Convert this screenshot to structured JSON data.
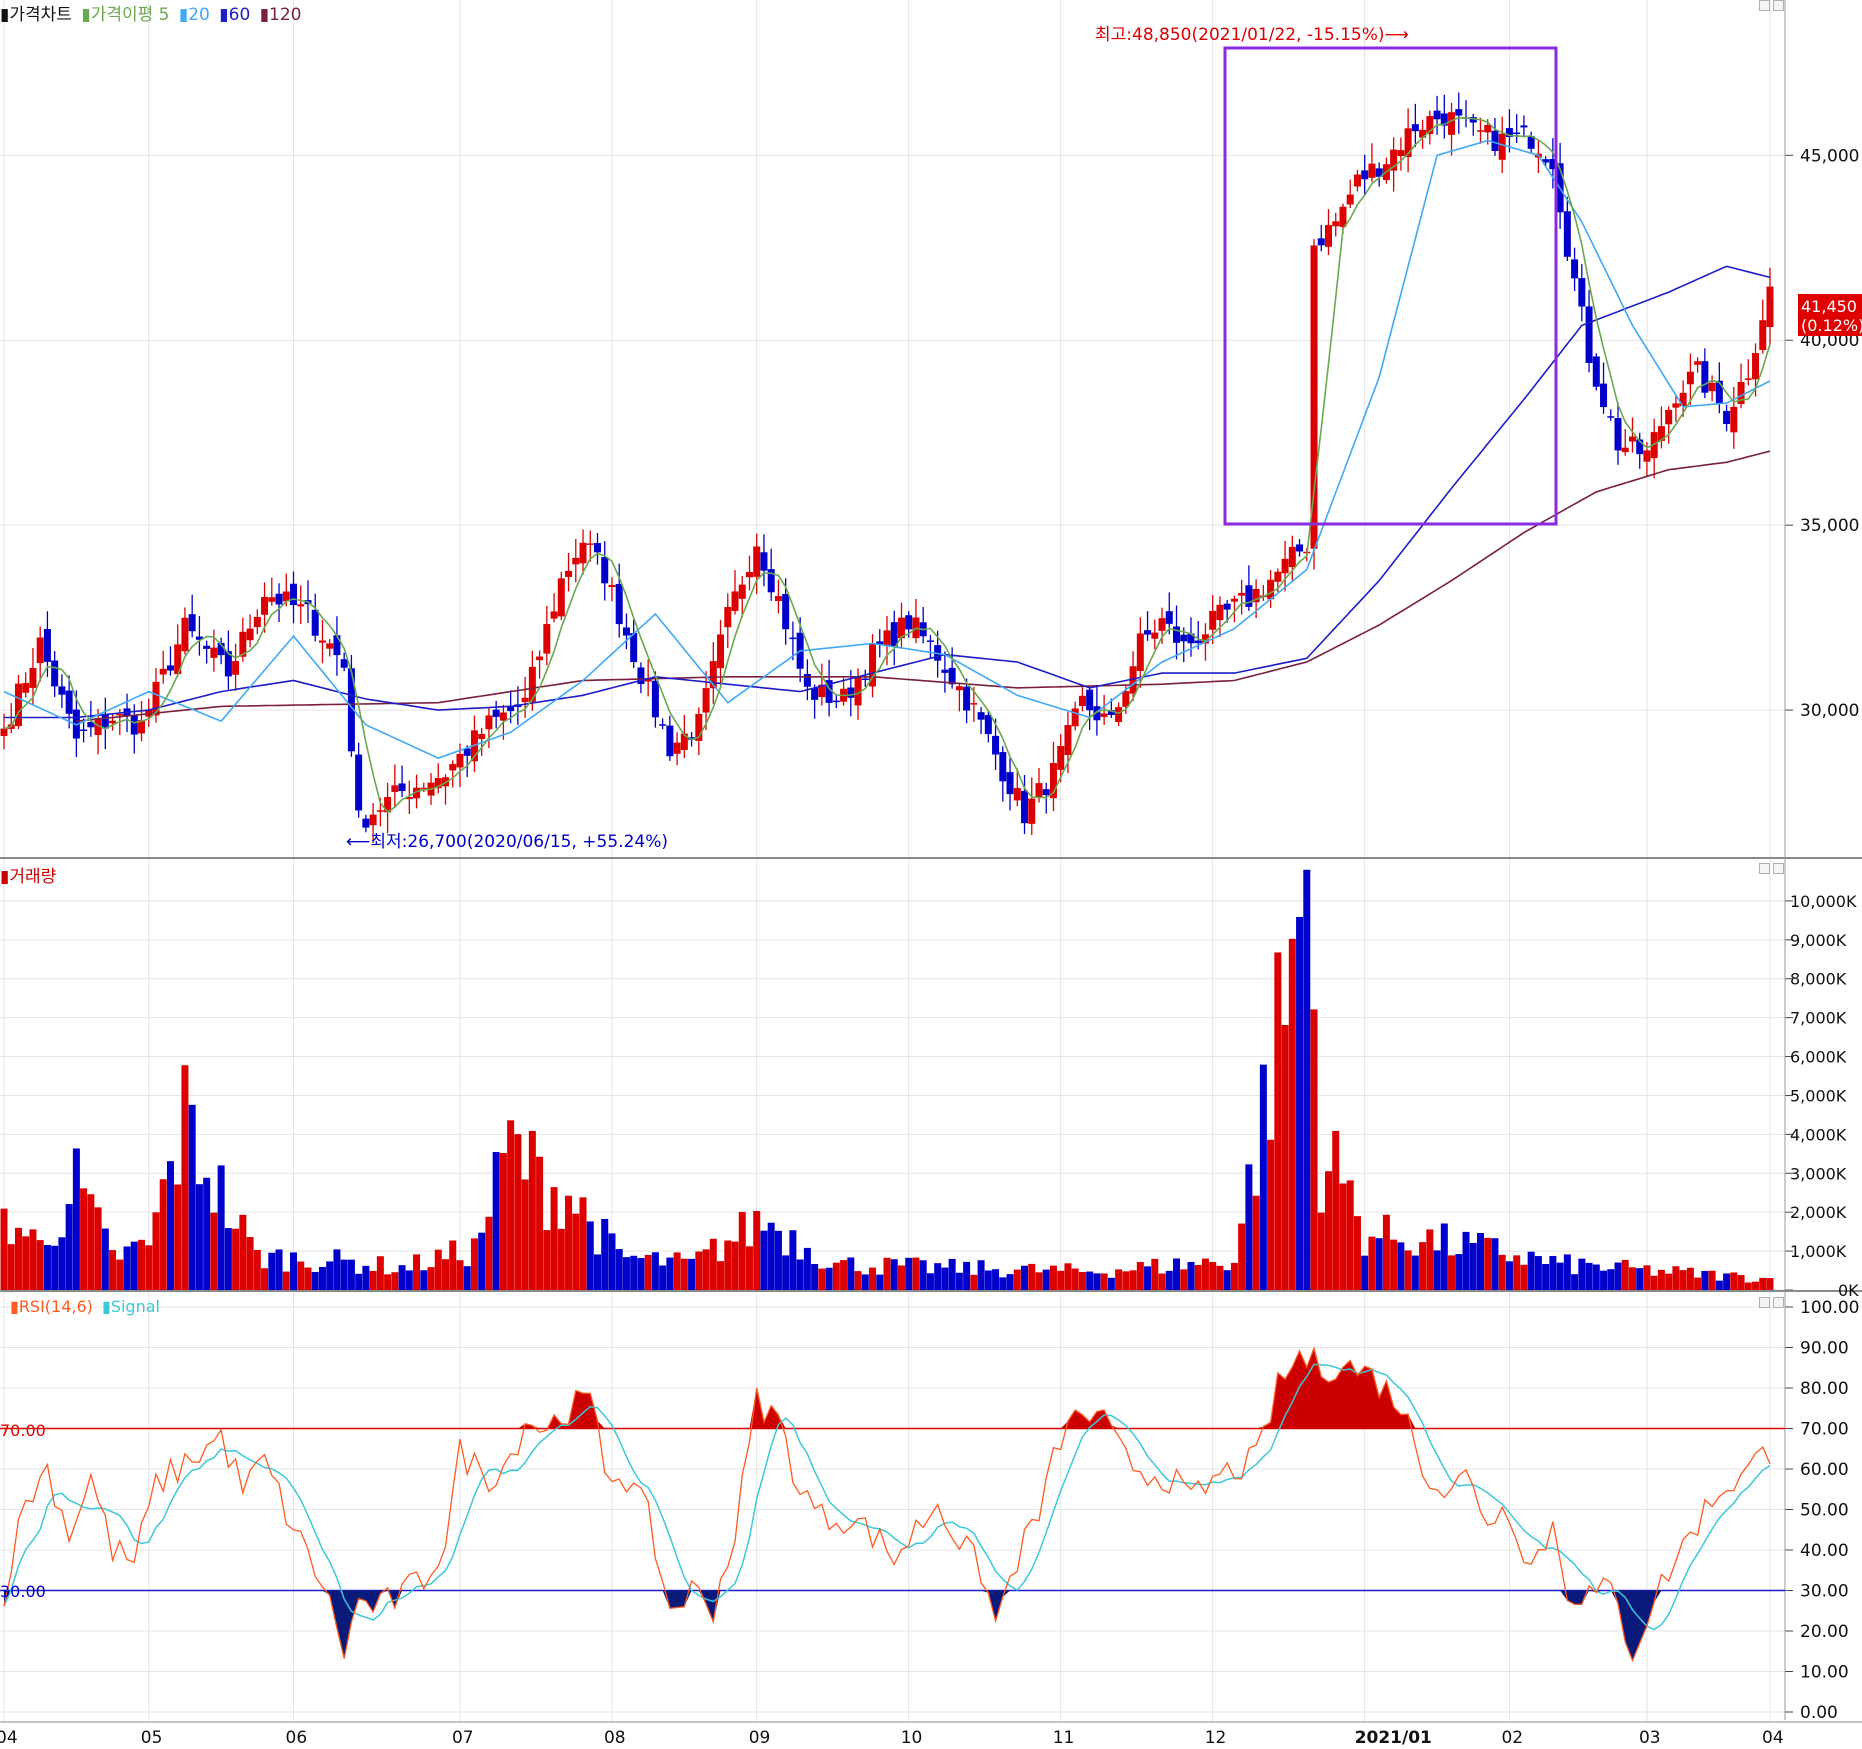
{
  "price_legend": {
    "items": [
      {
        "label": "가격차트",
        "color": "#111111"
      },
      {
        "label": "가격이평 5",
        "color": "#6aa84f"
      },
      {
        "label": "20",
        "color": "#3fa9f5"
      },
      {
        "label": "60",
        "color": "#1c1cc8"
      },
      {
        "label": "120",
        "color": "#7a1f3d"
      }
    ]
  },
  "volume_legend": {
    "label": "거래량",
    "color": "#cc0000"
  },
  "rsi_legend": {
    "items": [
      {
        "label": "RSI(14,6)",
        "color": "#ff5a1f"
      },
      {
        "label": "Signal",
        "color": "#3cc8d8"
      }
    ]
  },
  "annotations": {
    "high": "최고:48,850(2021/01/22, -15.15%)⟶",
    "low": "⟵최저:26,700(2020/06/15, +55.24%)",
    "last_price": "41,450",
    "last_change": "(0.12%)"
  },
  "colors": {
    "up": "#dd0000",
    "down": "#0000cc",
    "grid": "#e4e4e4",
    "box": "#8a2be2"
  },
  "chart_data": [
    {
      "type": "candlestick",
      "title": "가격차트",
      "x_ticks": [
        "04",
        "05",
        "06",
        "07",
        "08",
        "09",
        "10",
        "11",
        "12",
        "2021/01",
        "02",
        "03",
        "04"
      ],
      "y_ticks": [
        "30,000",
        "35,000",
        "40,000",
        "45,000"
      ],
      "ylim": [
        26000,
        49200
      ],
      "high": {
        "value": 48850,
        "date": "2021/01/22"
      },
      "low": {
        "value": 26700,
        "date": "2020/06/15"
      },
      "last": 41450,
      "series": [
        {
          "name": "가격차트",
          "kind": "candles",
          "anchors": [
            [
              0,
              29500
            ],
            [
              5,
              31800
            ],
            [
              10,
              29200
            ],
            [
              15,
              29800
            ],
            [
              19,
              29600
            ],
            [
              25,
              32200
            ],
            [
              31,
              31000
            ],
            [
              36,
              33200
            ],
            [
              42,
              32600
            ],
            [
              47,
              31200
            ],
            [
              49,
              27000
            ],
            [
              55,
              27800
            ],
            [
              61,
              28300
            ],
            [
              67,
              29600
            ],
            [
              72,
              30200
            ],
            [
              77,
              33500
            ],
            [
              80,
              34600
            ],
            [
              83,
              33700
            ],
            [
              88,
              31000
            ],
            [
              92,
              29000
            ],
            [
              96,
              29600
            ],
            [
              100,
              32500
            ],
            [
              104,
              34600
            ],
            [
              107,
              33000
            ],
            [
              111,
              30500
            ],
            [
              116,
              30300
            ],
            [
              120,
              31500
            ],
            [
              125,
              32400
            ],
            [
              129,
              31500
            ],
            [
              134,
              30000
            ],
            [
              137,
              28800
            ],
            [
              141,
              27200
            ],
            [
              145,
              28300
            ],
            [
              149,
              30200
            ],
            [
              153,
              29600
            ],
            [
              157,
              31800
            ],
            [
              160,
              32400
            ],
            [
              163,
              31700
            ],
            [
              168,
              32500
            ],
            [
              172,
              33000
            ],
            [
              176,
              33700
            ],
            [
              180,
              34500
            ],
            [
              181,
              42600
            ],
            [
              184,
              43200
            ],
            [
              187,
              44300
            ],
            [
              191,
              44900
            ],
            [
              195,
              45800
            ],
            [
              199,
              46100
            ],
            [
              203,
              45600
            ],
            [
              207,
              45400
            ],
            [
              211,
              45500
            ],
            [
              214,
              44900
            ],
            [
              216,
              42600
            ],
            [
              219,
              39600
            ],
            [
              223,
              37200
            ],
            [
              227,
              36900
            ],
            [
              231,
              38600
            ],
            [
              234,
              39100
            ],
            [
              238,
              38000
            ],
            [
              241,
              39200
            ],
            [
              244,
              41450
            ]
          ]
        },
        {
          "name": "가격이평 5",
          "kind": "line"
        },
        {
          "name": "20",
          "kind": "line",
          "anchors": [
            [
              0,
              30500
            ],
            [
              10,
              29600
            ],
            [
              20,
              30500
            ],
            [
              30,
              29700
            ],
            [
              40,
              32000
            ],
            [
              50,
              29600
            ],
            [
              60,
              28700
            ],
            [
              70,
              29400
            ],
            [
              80,
              30800
            ],
            [
              90,
              32600
            ],
            [
              100,
              30200
            ],
            [
              110,
              31600
            ],
            [
              120,
              31800
            ],
            [
              130,
              31500
            ],
            [
              140,
              30400
            ],
            [
              150,
              29800
            ],
            [
              160,
              31300
            ],
            [
              170,
              32200
            ],
            [
              180,
              33800
            ],
            [
              190,
              39000
            ],
            [
              198,
              45000
            ],
            [
              205,
              45400
            ],
            [
              212,
              45000
            ],
            [
              218,
              43200
            ],
            [
              225,
              40400
            ],
            [
              232,
              38200
            ],
            [
              238,
              38300
            ],
            [
              244,
              38900
            ]
          ]
        },
        {
          "name": "60",
          "kind": "line",
          "anchors": [
            [
              0,
              29800
            ],
            [
              10,
              29800
            ],
            [
              20,
              30000
            ],
            [
              30,
              30500
            ],
            [
              40,
              30800
            ],
            [
              50,
              30300
            ],
            [
              60,
              30000
            ],
            [
              70,
              30100
            ],
            [
              80,
              30400
            ],
            [
              90,
              30900
            ],
            [
              100,
              30700
            ],
            [
              110,
              30500
            ],
            [
              120,
              31000
            ],
            [
              130,
              31500
            ],
            [
              140,
              31300
            ],
            [
              150,
              30600
            ],
            [
              160,
              31000
            ],
            [
              170,
              31000
            ],
            [
              180,
              31400
            ],
            [
              190,
              33500
            ],
            [
              200,
              36000
            ],
            [
              210,
              38400
            ],
            [
              218,
              40400
            ],
            [
              230,
              41300
            ],
            [
              238,
              42000
            ],
            [
              244,
              41700
            ]
          ]
        },
        {
          "name": "120",
          "kind": "line",
          "anchors": [
            [
              10,
              29700
            ],
            [
              30,
              30100
            ],
            [
              60,
              30200
            ],
            [
              80,
              30800
            ],
            [
              100,
              30900
            ],
            [
              120,
              30900
            ],
            [
              140,
              30600
            ],
            [
              160,
              30700
            ],
            [
              170,
              30800
            ],
            [
              180,
              31300
            ],
            [
              190,
              32300
            ],
            [
              200,
              33500
            ],
            [
              210,
              34800
            ],
            [
              220,
              35900
            ],
            [
              230,
              36500
            ],
            [
              238,
              36700
            ],
            [
              244,
              37000
            ]
          ]
        }
      ]
    },
    {
      "type": "bar",
      "title": "거래량",
      "y_ticks": [
        "0K",
        "1,000K",
        "2,000K",
        "3,000K",
        "4,000K",
        "5,000K",
        "6,000K",
        "7,000K",
        "8,000K",
        "9,000K",
        "10,000K"
      ],
      "ylim": [
        0,
        11000
      ],
      "unit": "K",
      "peak": {
        "value": 10800,
        "date": "2020/12/31"
      },
      "anchors": [
        [
          0,
          2000
        ],
        [
          5,
          1200
        ],
        [
          10,
          2800
        ],
        [
          15,
          900
        ],
        [
          20,
          1200
        ],
        [
          25,
          4600
        ],
        [
          31,
          2200
        ],
        [
          35,
          900
        ],
        [
          45,
          800
        ],
        [
          55,
          600
        ],
        [
          65,
          1100
        ],
        [
          70,
          3900
        ],
        [
          75,
          2800
        ],
        [
          78,
          2600
        ],
        [
          85,
          900
        ],
        [
          95,
          700
        ],
        [
          105,
          1900
        ],
        [
          115,
          700
        ],
        [
          130,
          600
        ],
        [
          150,
          500
        ],
        [
          170,
          800
        ],
        [
          180,
          10800
        ],
        [
          182,
          3600
        ],
        [
          185,
          3000
        ],
        [
          188,
          1500
        ],
        [
          195,
          1400
        ],
        [
          205,
          1100
        ],
        [
          215,
          700
        ],
        [
          244,
          300
        ]
      ]
    },
    {
      "type": "line",
      "title": "RSI(14,6)",
      "y_ticks": [
        "0.00",
        "10.00",
        "20.00",
        "30.00",
        "40.00",
        "50.00",
        "60.00",
        "70.00",
        "80.00",
        "90.00",
        "100.00"
      ],
      "ylim": [
        0,
        100
      ],
      "reference_lines": [
        {
          "value": 70,
          "label": "70.00"
        },
        {
          "value": 30,
          "label": "30.00"
        }
      ],
      "series": [
        {
          "name": "RSI(14,6)",
          "anchors": [
            [
              0,
              30
            ],
            [
              3,
              52
            ],
            [
              6,
              60
            ],
            [
              9,
              44
            ],
            [
              12,
              58
            ],
            [
              15,
              40
            ],
            [
              18,
              37
            ],
            [
              21,
              56
            ],
            [
              24,
              60
            ],
            [
              27,
              64
            ],
            [
              30,
              68
            ],
            [
              33,
              55
            ],
            [
              36,
              62
            ],
            [
              40,
              45
            ],
            [
              44,
              32
            ],
            [
              47,
              15
            ],
            [
              49,
              27
            ],
            [
              52,
              26
            ],
            [
              55,
              29
            ],
            [
              58,
              33
            ],
            [
              61,
              42
            ],
            [
              63,
              64
            ],
            [
              67,
              58
            ],
            [
              70,
              63
            ],
            [
              72,
              72
            ],
            [
              75,
              70
            ],
            [
              78,
              75
            ],
            [
              81,
              77
            ],
            [
              83,
              60
            ],
            [
              86,
              58
            ],
            [
              89,
              48
            ],
            [
              92,
              25
            ],
            [
              95,
              30
            ],
            [
              98,
              26
            ],
            [
              101,
              44
            ],
            [
              104,
              77
            ],
            [
              107,
              72
            ],
            [
              110,
              55
            ],
            [
              113,
              48
            ],
            [
              117,
              48
            ],
            [
              120,
              44
            ],
            [
              123,
              38
            ],
            [
              126,
              45
            ],
            [
              129,
              52
            ],
            [
              132,
              42
            ],
            [
              135,
              35
            ],
            [
              137,
              22
            ],
            [
              140,
              38
            ],
            [
              143,
              49
            ],
            [
              146,
              68
            ],
            [
              149,
              74
            ],
            [
              152,
              71
            ],
            [
              155,
              62
            ],
            [
              158,
              59
            ],
            [
              161,
              58
            ],
            [
              164,
              52
            ],
            [
              167,
              57
            ],
            [
              170,
              60
            ],
            [
              173,
              62
            ],
            [
              176,
              80
            ],
            [
              179,
              88
            ],
            [
              182,
              85
            ],
            [
              185,
              86
            ],
            [
              189,
              83
            ],
            [
              193,
              76
            ],
            [
              196,
              61
            ],
            [
              199,
              55
            ],
            [
              202,
              58
            ],
            [
              205,
              48
            ],
            [
              208,
              50
            ],
            [
              211,
              36
            ],
            [
              214,
              46
            ],
            [
              216,
              30
            ],
            [
              219,
              29
            ],
            [
              222,
              30
            ],
            [
              225,
              15
            ],
            [
              228,
              28
            ],
            [
              231,
              38
            ],
            [
              234,
              47
            ],
            [
              237,
              55
            ],
            [
              240,
              58
            ],
            [
              244,
              65
            ]
          ]
        },
        {
          "name": "Signal"
        }
      ]
    }
  ]
}
